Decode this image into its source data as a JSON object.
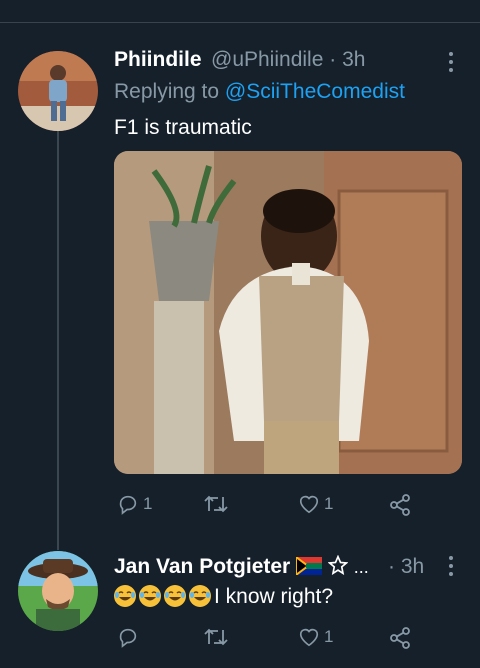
{
  "tweets": [
    {
      "display_name": "Phiindile",
      "handle": "@uPhiindile",
      "separator": "·",
      "time": "3h",
      "replying_prefix": "Replying to",
      "replying_to": "@SciiTheComedist",
      "text": "F1 is traumatic",
      "actions": {
        "replies": "1",
        "retweets": "",
        "likes": "1"
      }
    },
    {
      "display_name": "Jan Van Potgieter",
      "name_suffix": "...",
      "separator": "·",
      "time": "3h",
      "text": "I know right?",
      "emoji_count": 4,
      "actions": {
        "replies": "",
        "retweets": "",
        "likes": "1"
      }
    }
  ],
  "icons": [
    "reply-icon",
    "retweet-icon",
    "like-icon",
    "share-icon",
    "more-icon",
    "flag-icon",
    "star-icon",
    "laughing-emoji-icon"
  ],
  "colors": {
    "background": "#15202b",
    "link": "#1da1f2",
    "muted": "#8899a6",
    "divider": "#38444d"
  }
}
